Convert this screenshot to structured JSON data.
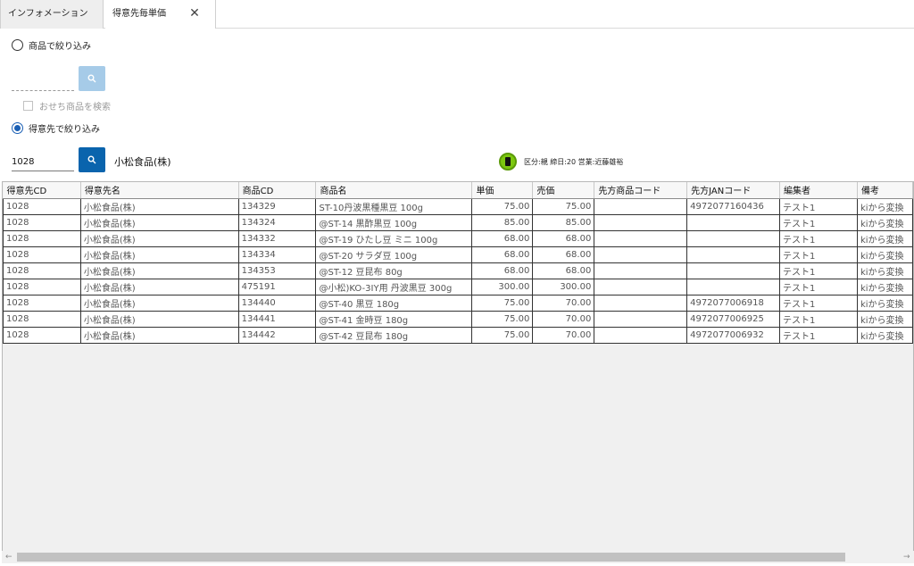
{
  "tabs": [
    {
      "label": "インフォメーション"
    },
    {
      "label": "得意先毎単価"
    }
  ],
  "tab_close": "✕",
  "filter": {
    "product_radio_label": "商品で絞り込み",
    "osechi_label": "おせち商品を検索",
    "customer_radio_label": "得意先で絞り込み",
    "customer_code": "1028",
    "customer_name": "小松食品(株)",
    "info_text": "区分:親 締日:20 営業:近藤雄裕"
  },
  "columns": [
    "得意先CD",
    "得意先名",
    "商品CD",
    "商品名",
    "単価",
    "売価",
    "先方商品コード",
    "先方JANコード",
    "編集者",
    "備考"
  ],
  "rows": [
    [
      "1028",
      "小松食品(株)",
      "134329",
      "ST-10丹波黒種黒豆 100g",
      "75.00",
      "75.00",
      "",
      "4972077160436",
      "テスト1",
      "kiから変換"
    ],
    [
      "1028",
      "小松食品(株)",
      "134324",
      "@ST-14 黒酢黒豆 100g",
      "85.00",
      "85.00",
      "",
      "",
      "テスト1",
      "kiから変換"
    ],
    [
      "1028",
      "小松食品(株)",
      "134332",
      "@ST-19 ひたし豆 ミニ 100g",
      "68.00",
      "68.00",
      "",
      "",
      "テスト1",
      "kiから変換"
    ],
    [
      "1028",
      "小松食品(株)",
      "134334",
      "@ST-20 サラダ豆 100g",
      "68.00",
      "68.00",
      "",
      "",
      "テスト1",
      "kiから変換"
    ],
    [
      "1028",
      "小松食品(株)",
      "134353",
      "@ST-12 豆昆布 80g",
      "68.00",
      "68.00",
      "",
      "",
      "テスト1",
      "kiから変換"
    ],
    [
      "1028",
      "小松食品(株)",
      "475191",
      "@小松)KO-3IY用 丹波黒豆 300g",
      "300.00",
      "300.00",
      "",
      "",
      "テスト1",
      "kiから変換"
    ],
    [
      "1028",
      "小松食品(株)",
      "134440",
      "@ST-40 黒豆 180g",
      "75.00",
      "70.00",
      "",
      "4972077006918",
      "テスト1",
      "kiから変換"
    ],
    [
      "1028",
      "小松食品(株)",
      "134441",
      "@ST-41 金時豆 180g",
      "75.00",
      "70.00",
      "",
      "4972077006925",
      "テスト1",
      "kiから変換"
    ],
    [
      "1028",
      "小松食品(株)",
      "134442",
      "@ST-42 豆昆布 180g",
      "75.00",
      "70.00",
      "",
      "4972077006932",
      "テスト1",
      "kiから変換"
    ]
  ],
  "colors": {
    "accent": "#0a64ad",
    "accent_disabled": "#a6cbe8",
    "warning": "#7cc70f"
  }
}
